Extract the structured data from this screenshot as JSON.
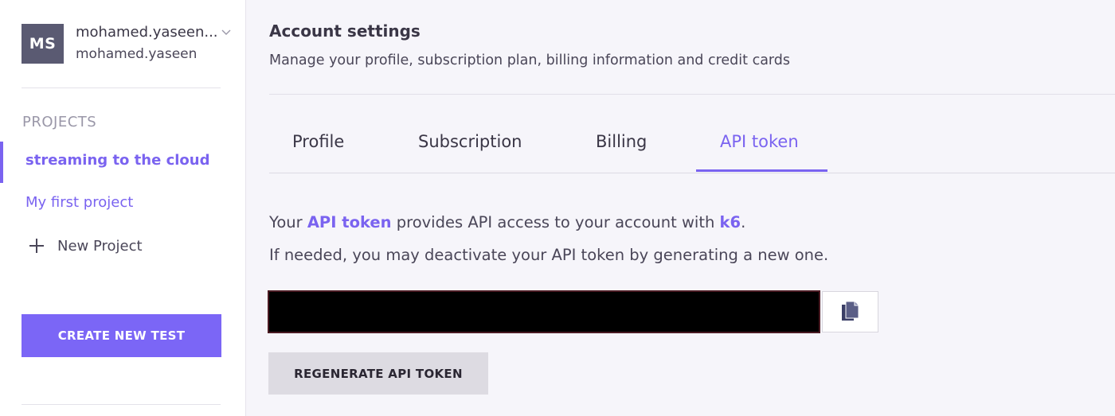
{
  "user": {
    "initials": "MS",
    "display_name": "mohamed.yaseen...",
    "username": "mohamed.yaseen"
  },
  "sidebar": {
    "projects_heading": "PROJECTS",
    "projects": [
      {
        "label": "streaming to the cloud",
        "active": true
      },
      {
        "label": "My first project",
        "active": false
      }
    ],
    "new_project_label": "New Project",
    "create_test_label": "CREATE NEW TEST"
  },
  "header": {
    "title": "Account settings",
    "subtitle": "Manage your profile, subscription plan, billing information and credit cards"
  },
  "tabs": [
    {
      "label": "Profile",
      "active": false
    },
    {
      "label": "Subscription",
      "active": false
    },
    {
      "label": "Billing",
      "active": false
    },
    {
      "label": "API token",
      "active": true
    }
  ],
  "api_token": {
    "line1_prefix": "Your ",
    "line1_link": "API token",
    "line1_middle": " provides API access to your account with ",
    "line1_brand": "k6",
    "line1_suffix": ".",
    "line2": "If needed, you may deactivate your API token by generating a new one.",
    "regenerate_label": "REGENERATE API TOKEN"
  },
  "icons": {
    "avatar_chevron": "chevron-down-icon",
    "new_project": "plus-icon",
    "copy": "copy-icon"
  },
  "colors": {
    "accent": "#7a63f0",
    "create_button": "#7b66f6",
    "regenerate_button": "#dddbe2",
    "token_field": "#000000"
  }
}
